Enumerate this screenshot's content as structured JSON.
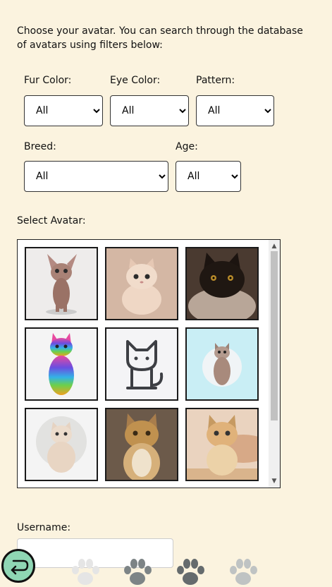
{
  "intro": "Choose your avatar. You can search through the database of avatars using filters below:",
  "filters": {
    "fur_color": {
      "label": "Fur Color:",
      "value": "All"
    },
    "eye_color": {
      "label": "Eye Color:",
      "value": "All"
    },
    "pattern": {
      "label": "Pattern:",
      "value": "All"
    },
    "breed": {
      "label": "Breed:",
      "value": "All"
    },
    "age": {
      "label": "Age:",
      "value": "All"
    }
  },
  "select_avatar_label": "Select Avatar:",
  "avatars": [
    {
      "icon": "sphynx-cat-icon"
    },
    {
      "icon": "cream-chubby-cat-icon"
    },
    {
      "icon": "black-fluffy-cat-icon"
    },
    {
      "icon": "rainbow-cat-icon"
    },
    {
      "icon": "line-art-cat-icon"
    },
    {
      "icon": "tabby-kitten-icon"
    },
    {
      "icon": "british-shorthair-cat-icon"
    },
    {
      "icon": "wild-cat-icon"
    },
    {
      "icon": "sand-cat-icon"
    }
  ],
  "username_label": "Username:",
  "username_value": "",
  "colors": {
    "background": "#fbf3df",
    "back_button": "#8fd6b4"
  }
}
